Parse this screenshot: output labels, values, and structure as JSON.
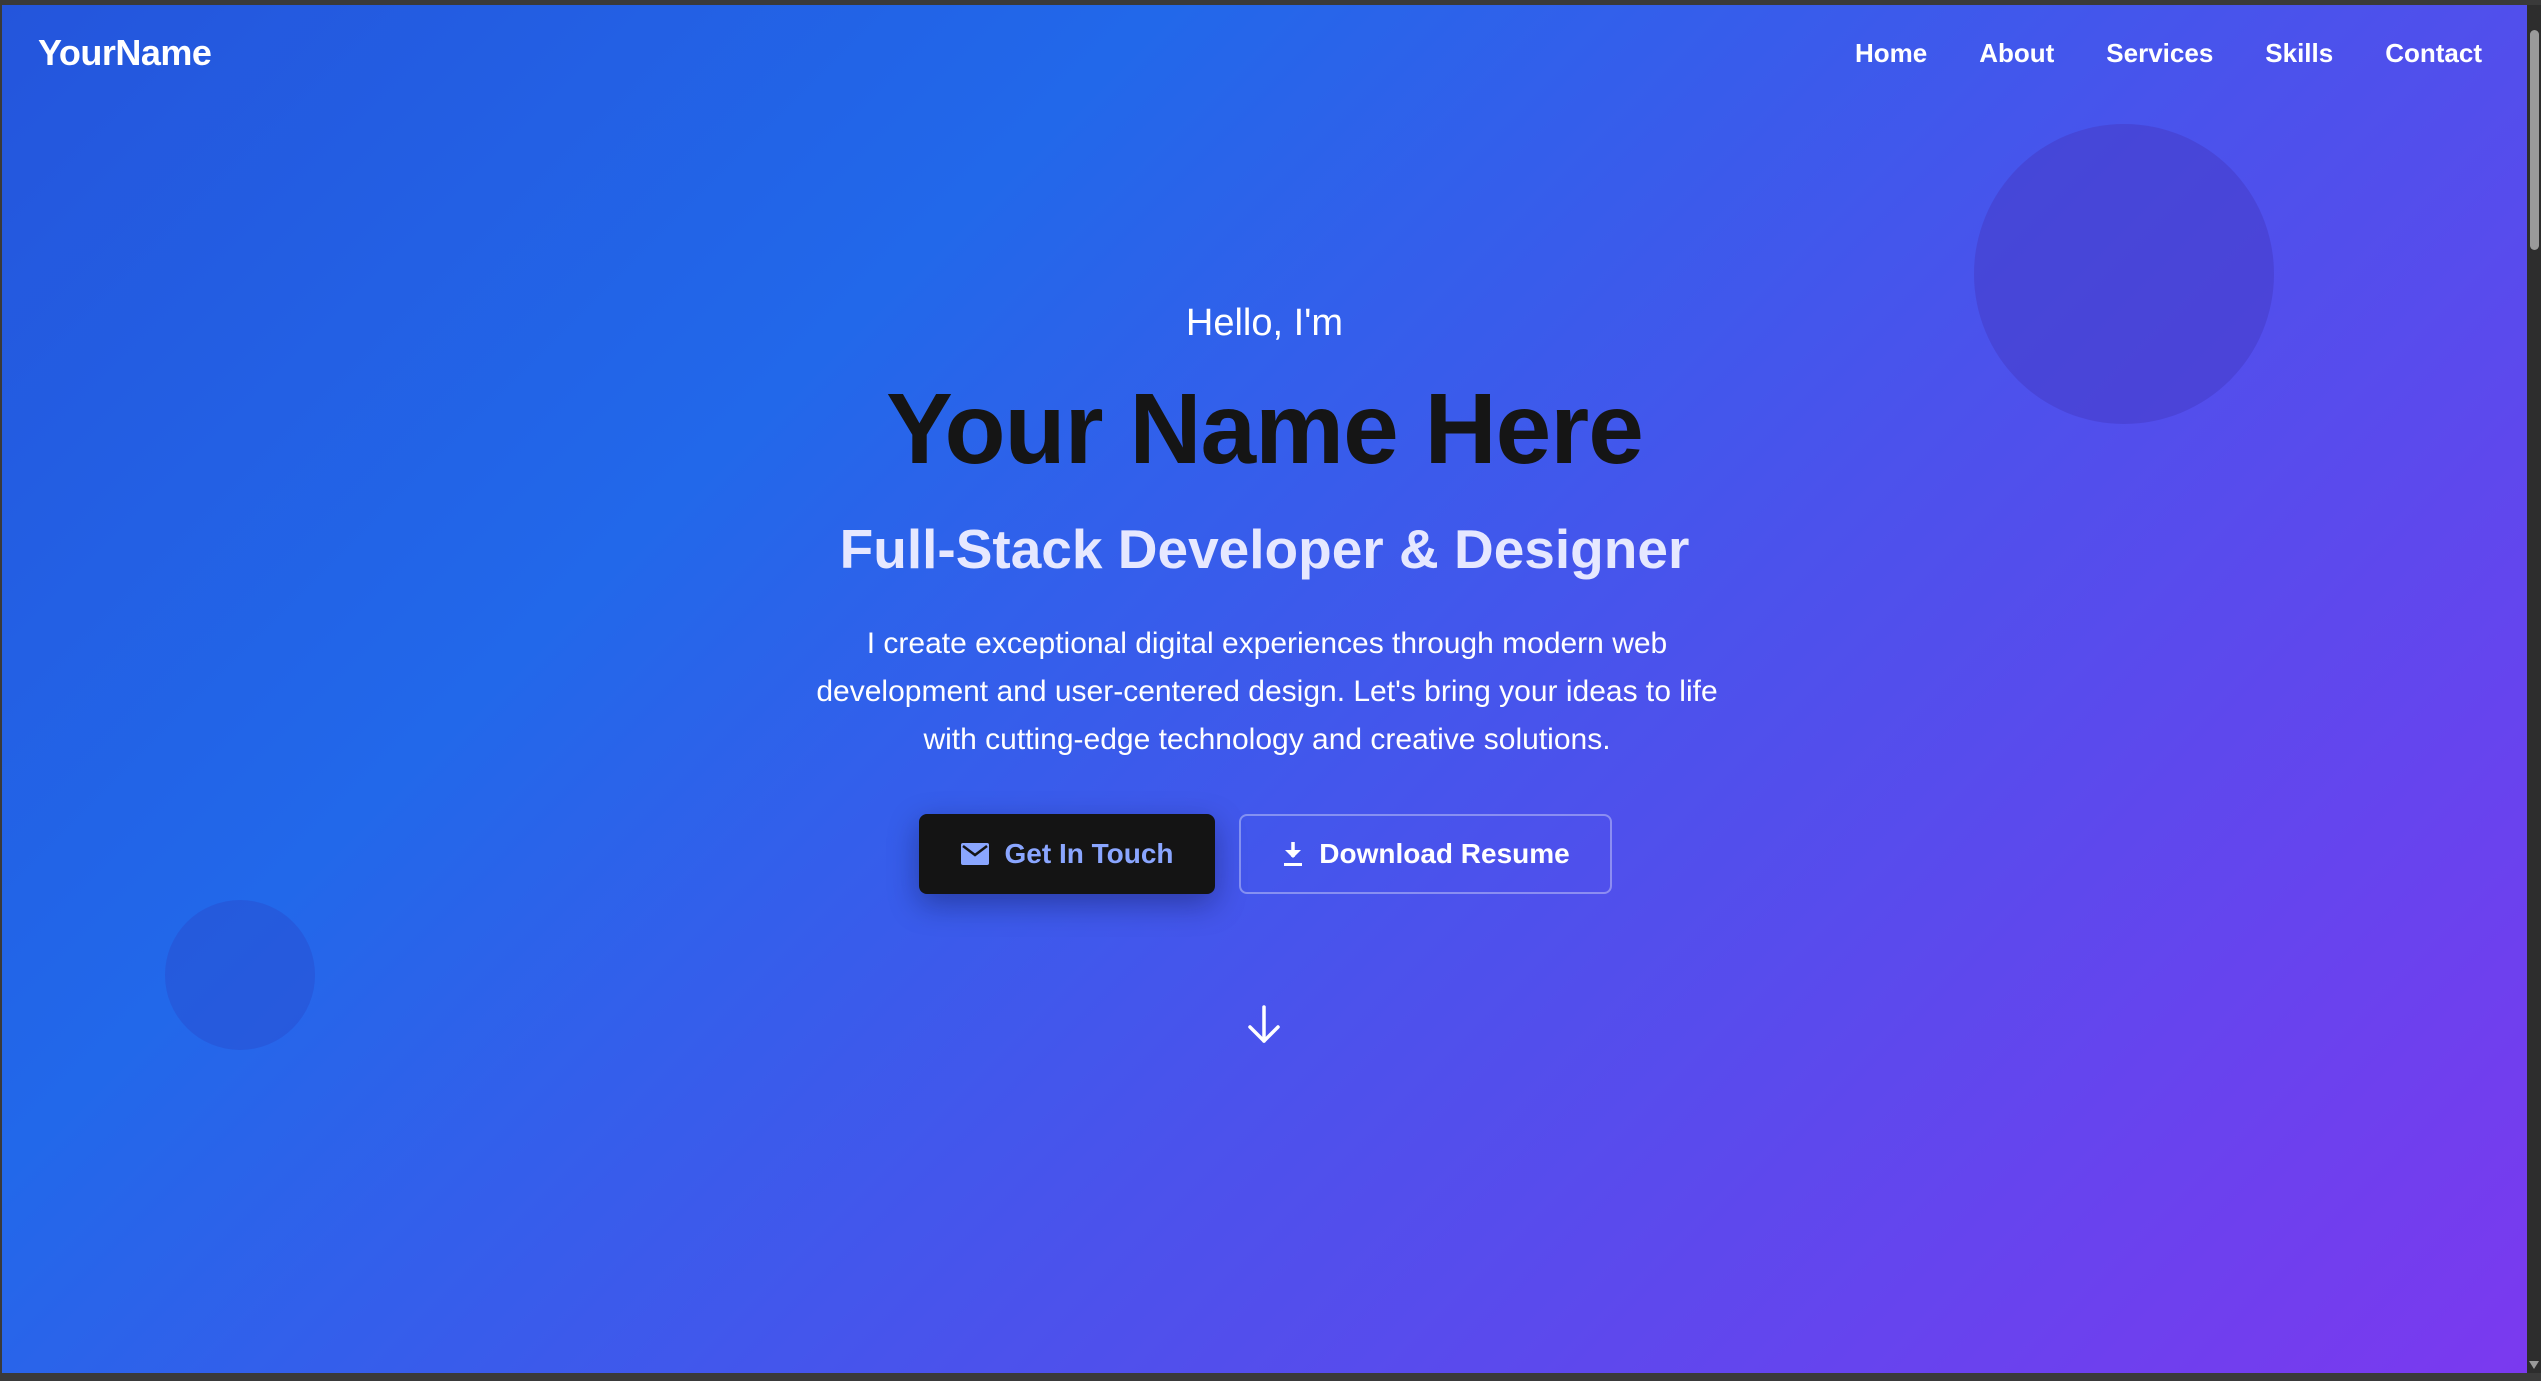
{
  "nav": {
    "logo": "YourName",
    "links": [
      "Home",
      "About",
      "Services",
      "Skills",
      "Contact"
    ]
  },
  "hero": {
    "greeting": "Hello, I'm",
    "name": "Your Name Here",
    "role": "Full-Stack Developer & Designer",
    "description": "I create exceptional digital experiences through modern web development and user-centered design. Let's bring your ideas to life with cutting-edge technology and creative solutions.",
    "primary_button": {
      "label": "Get In Touch",
      "icon": "mail-icon"
    },
    "secondary_button": {
      "label": "Download Resume",
      "icon": "download-icon"
    },
    "scroll_icon": "arrow-down-icon"
  },
  "colors": {
    "gradient_start": "#2455dc",
    "gradient_end": "#7b39ef",
    "primary_button_bg": "#141414",
    "primary_button_text": "#8aa6ff",
    "name_text": "#151515"
  }
}
